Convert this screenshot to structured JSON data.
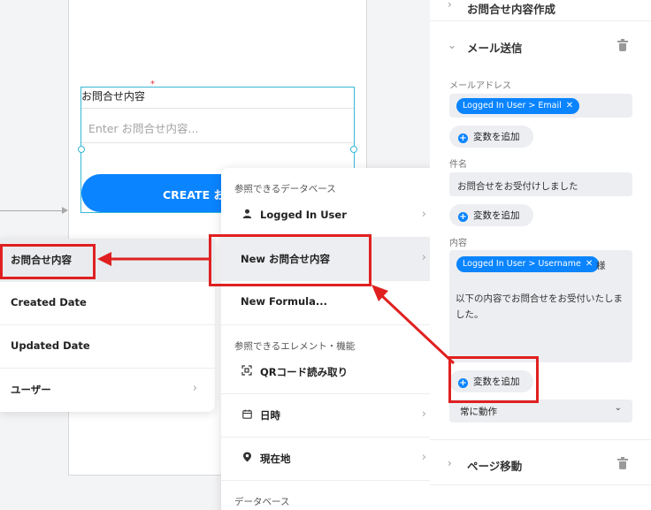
{
  "canvas": {
    "field_label": "お問合せ内容",
    "field_placeholder": "Enter お問合せ内容...",
    "required_mark": "*",
    "create_button": "CREATE お問"
  },
  "left_menu": {
    "items": [
      {
        "label": "お問合せ内容",
        "chevron": ""
      },
      {
        "label": "Created Date",
        "chevron": ""
      },
      {
        "label": "Updated Date",
        "chevron": ""
      },
      {
        "label": "ユーザー",
        "chevron": "›"
      }
    ]
  },
  "mid_menu": {
    "section1": "参照できるデータベース",
    "logged_in_user": "Logged In User",
    "new_inquiry": "New お問合せ内容",
    "new_formula": "New Formula...",
    "section2": "参照できるエレメント・機能",
    "qr": "QRコード読み取り",
    "datetime": "日時",
    "location": "現在地",
    "section3": "データベース",
    "chevron": "›"
  },
  "panel": {
    "prev_section": "お問合せ内容作成",
    "email_section": "メール送信",
    "email_label": "メールアドレス",
    "email_chip": "Logged In User > Email",
    "chip_close": "✕",
    "add_variable": "変数を追加",
    "subject_label": "件名",
    "subject_value": "お問合せをお受付けしました",
    "content_label": "内容",
    "content_chip": "Logged In User > Username",
    "content_suffix": "様",
    "content_body": "以下の内容でお問合せをお受付いたしました。",
    "condition": "常に動作",
    "page_move": "ページ移動",
    "chevron_right": "›",
    "chevron_down": "⌄"
  },
  "colors": {
    "accent": "#0a84ff",
    "annotation": "#e02020",
    "selection": "#36b8d6"
  }
}
